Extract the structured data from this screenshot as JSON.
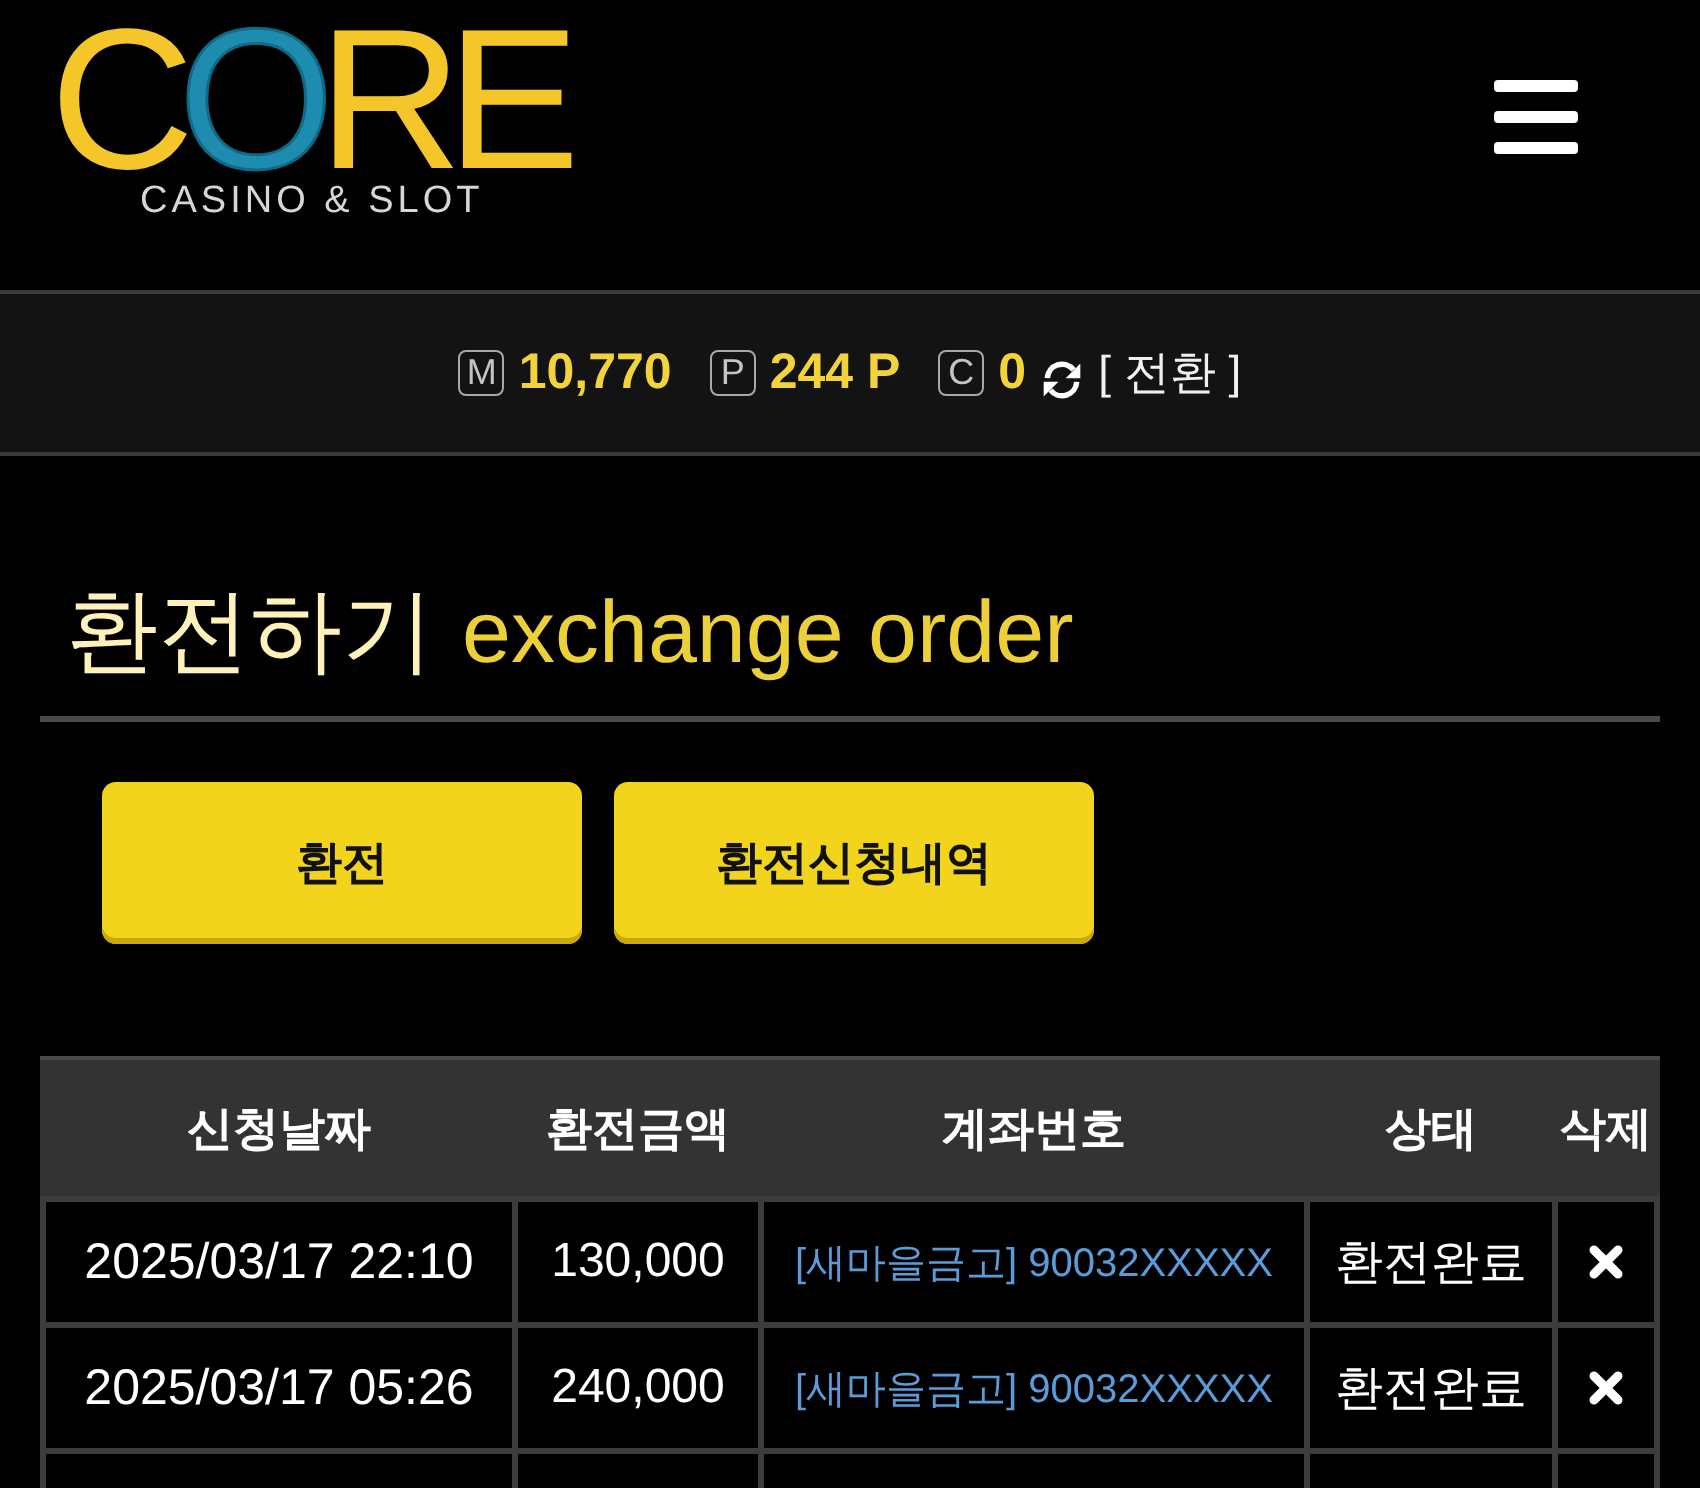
{
  "header": {
    "logo": {
      "wordmark": "CORE",
      "tagline": "CASINO & SLOT"
    }
  },
  "balance_bar": {
    "items": [
      {
        "badge": "M",
        "value": "10,770"
      },
      {
        "badge": "P",
        "value": "244 P"
      },
      {
        "badge": "C",
        "value": "0"
      }
    ],
    "convert_link": "[ 전환 ]"
  },
  "page_title": {
    "korean": "환전하기",
    "english": "exchange order"
  },
  "buttons": [
    {
      "label": "환전"
    },
    {
      "label": "환전신청내역"
    }
  ],
  "table": {
    "columns": [
      "신청날짜",
      "환전금액",
      "계좌번호",
      "상태",
      "삭제"
    ],
    "rows": [
      {
        "date": "2025/03/17 22:10",
        "amount": "130,000",
        "account": "[새마을금고] 90032XXXXX",
        "status": "환전완료"
      },
      {
        "date": "2025/03/17 05:26",
        "amount": "240,000",
        "account": "[새마을금고] 90032XXXXX",
        "status": "환전완료"
      }
    ]
  }
}
